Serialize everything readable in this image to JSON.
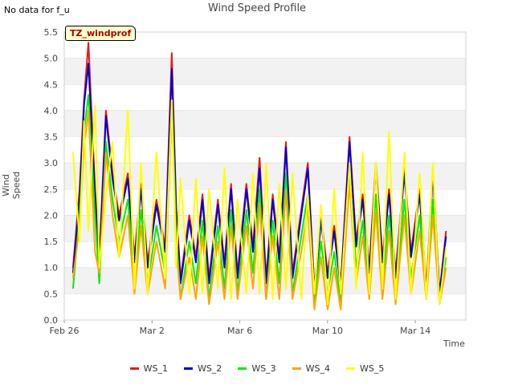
{
  "corner_note": "No data for f_u",
  "chart_data": {
    "type": "line",
    "title": "Wind Speed Profile",
    "site_label": "TZ_windprof",
    "xlabel": "Time",
    "ylabel": "Wind Speed",
    "x_ticks": [
      "Feb 26",
      "Mar 2",
      "Mar 6",
      "Mar 10",
      "Mar 14"
    ],
    "x_tick_days": [
      0,
      4,
      8,
      12,
      16
    ],
    "x_range_days": [
      0,
      18.3
    ],
    "y_ticks": [
      "0.0",
      "0.5",
      "1.0",
      "1.5",
      "2.0",
      "2.5",
      "3.0",
      "3.5",
      "4.0",
      "4.5",
      "5.0",
      "5.5"
    ],
    "ylim": [
      0,
      5.5
    ],
    "grid": "horizontal bands",
    "legend_position": "bottom",
    "series": [
      {
        "name": "WS_1",
        "color": "#e31a1c",
        "values": [
          [
            0.4,
            1.0
          ],
          [
            0.7,
            2.5
          ],
          [
            0.9,
            4.2
          ],
          [
            1.1,
            5.3
          ],
          [
            1.4,
            2.5
          ],
          [
            1.6,
            1.2
          ],
          [
            1.9,
            4.0
          ],
          [
            2.2,
            2.8
          ],
          [
            2.5,
            2.0
          ],
          [
            2.9,
            2.8
          ],
          [
            3.2,
            1.2
          ],
          [
            3.5,
            2.6
          ],
          [
            3.8,
            1.1
          ],
          [
            4.2,
            2.3
          ],
          [
            4.6,
            1.4
          ],
          [
            4.9,
            5.1
          ],
          [
            5.1,
            2.2
          ],
          [
            5.3,
            0.8
          ],
          [
            5.7,
            2.0
          ],
          [
            6.0,
            1.2
          ],
          [
            6.3,
            2.4
          ],
          [
            6.6,
            0.8
          ],
          [
            7.0,
            2.3
          ],
          [
            7.3,
            1.1
          ],
          [
            7.6,
            2.6
          ],
          [
            7.9,
            0.9
          ],
          [
            8.3,
            2.6
          ],
          [
            8.6,
            1.4
          ],
          [
            8.9,
            3.1
          ],
          [
            9.2,
            0.8
          ],
          [
            9.5,
            2.4
          ],
          [
            9.8,
            1.2
          ],
          [
            10.1,
            3.4
          ],
          [
            10.4,
            0.9
          ],
          [
            10.8,
            2.1
          ],
          [
            11.1,
            3.0
          ],
          [
            11.4,
            0.6
          ],
          [
            11.7,
            2.0
          ],
          [
            12.0,
            0.9
          ],
          [
            12.3,
            1.8
          ],
          [
            12.6,
            0.7
          ],
          [
            13.0,
            3.5
          ],
          [
            13.3,
            1.5
          ],
          [
            13.6,
            2.4
          ],
          [
            13.9,
            1.0
          ],
          [
            14.2,
            3.0
          ],
          [
            14.5,
            1.2
          ],
          [
            14.8,
            2.5
          ],
          [
            15.1,
            0.9
          ],
          [
            15.5,
            2.9
          ],
          [
            15.8,
            1.3
          ],
          [
            16.2,
            2.5
          ],
          [
            16.5,
            0.6
          ],
          [
            16.8,
            2.9
          ],
          [
            17.1,
            0.5
          ],
          [
            17.4,
            1.7
          ]
        ]
      },
      {
        "name": "WS_2",
        "color": "#0000cc",
        "values": [
          [
            0.4,
            0.9
          ],
          [
            0.7,
            2.3
          ],
          [
            0.9,
            4.1
          ],
          [
            1.1,
            4.9
          ],
          [
            1.4,
            2.4
          ],
          [
            1.6,
            1.1
          ],
          [
            1.9,
            3.9
          ],
          [
            2.2,
            2.7
          ],
          [
            2.5,
            1.9
          ],
          [
            2.9,
            2.7
          ],
          [
            3.2,
            1.1
          ],
          [
            3.5,
            2.5
          ],
          [
            3.8,
            1.0
          ],
          [
            4.2,
            2.2
          ],
          [
            4.6,
            1.3
          ],
          [
            4.9,
            4.8
          ],
          [
            5.1,
            2.1
          ],
          [
            5.3,
            0.7
          ],
          [
            5.7,
            1.9
          ],
          [
            6.0,
            1.1
          ],
          [
            6.3,
            2.3
          ],
          [
            6.6,
            0.7
          ],
          [
            7.0,
            2.2
          ],
          [
            7.3,
            1.0
          ],
          [
            7.6,
            2.5
          ],
          [
            7.9,
            0.8
          ],
          [
            8.3,
            2.5
          ],
          [
            8.6,
            1.3
          ],
          [
            8.9,
            2.9
          ],
          [
            9.2,
            0.7
          ],
          [
            9.5,
            2.3
          ],
          [
            9.8,
            1.1
          ],
          [
            10.1,
            3.3
          ],
          [
            10.4,
            0.8
          ],
          [
            10.8,
            2.0
          ],
          [
            11.1,
            2.9
          ],
          [
            11.4,
            0.5
          ],
          [
            11.7,
            1.9
          ],
          [
            12.0,
            0.8
          ],
          [
            12.3,
            1.7
          ],
          [
            12.6,
            0.6
          ],
          [
            13.0,
            3.4
          ],
          [
            13.3,
            1.4
          ],
          [
            13.6,
            2.3
          ],
          [
            13.9,
            0.9
          ],
          [
            14.2,
            2.9
          ],
          [
            14.5,
            1.1
          ],
          [
            14.8,
            2.4
          ],
          [
            15.1,
            0.8
          ],
          [
            15.5,
            2.8
          ],
          [
            15.8,
            1.2
          ],
          [
            16.2,
            2.4
          ],
          [
            16.5,
            0.5
          ],
          [
            16.8,
            2.8
          ],
          [
            17.1,
            0.5
          ],
          [
            17.4,
            1.6
          ]
        ]
      },
      {
        "name": "WS_3",
        "color": "#00ee00",
        "values": [
          [
            0.4,
            0.6
          ],
          [
            0.7,
            2.0
          ],
          [
            0.9,
            3.6
          ],
          [
            1.1,
            4.3
          ],
          [
            1.4,
            2.0
          ],
          [
            1.6,
            0.7
          ],
          [
            1.9,
            3.4
          ],
          [
            2.2,
            2.3
          ],
          [
            2.5,
            1.5
          ],
          [
            2.9,
            2.3
          ],
          [
            3.2,
            0.8
          ],
          [
            3.5,
            2.1
          ],
          [
            3.8,
            0.7
          ],
          [
            4.2,
            1.8
          ],
          [
            4.6,
            0.9
          ],
          [
            4.9,
            4.2
          ],
          [
            5.1,
            1.7
          ],
          [
            5.3,
            0.4
          ],
          [
            5.7,
            1.5
          ],
          [
            6.0,
            0.7
          ],
          [
            6.3,
            1.9
          ],
          [
            6.6,
            0.4
          ],
          [
            7.0,
            1.8
          ],
          [
            7.3,
            0.6
          ],
          [
            7.6,
            2.1
          ],
          [
            7.9,
            0.5
          ],
          [
            8.3,
            2.1
          ],
          [
            8.6,
            0.9
          ],
          [
            8.9,
            2.5
          ],
          [
            9.2,
            0.4
          ],
          [
            9.5,
            1.9
          ],
          [
            9.8,
            0.7
          ],
          [
            10.1,
            2.8
          ],
          [
            10.4,
            0.5
          ],
          [
            10.8,
            1.6
          ],
          [
            11.1,
            2.4
          ],
          [
            11.4,
            0.3
          ],
          [
            11.7,
            1.5
          ],
          [
            12.0,
            0.5
          ],
          [
            12.3,
            1.3
          ],
          [
            12.6,
            0.3
          ],
          [
            13.0,
            2.9
          ],
          [
            13.3,
            1.0
          ],
          [
            13.6,
            1.9
          ],
          [
            13.9,
            0.5
          ],
          [
            14.2,
            2.4
          ],
          [
            14.5,
            0.7
          ],
          [
            14.8,
            2.0
          ],
          [
            15.1,
            0.5
          ],
          [
            15.5,
            2.3
          ],
          [
            15.8,
            0.8
          ],
          [
            16.2,
            2.0
          ],
          [
            16.5,
            0.4
          ],
          [
            16.8,
            2.3
          ],
          [
            17.1,
            0.4
          ],
          [
            17.4,
            1.2
          ]
        ]
      },
      {
        "name": "WS_4",
        "color": "#ffa500",
        "values": [
          [
            0.4,
            0.8
          ],
          [
            0.7,
            1.8
          ],
          [
            0.9,
            3.3
          ],
          [
            1.1,
            4.0
          ],
          [
            1.4,
            1.3
          ],
          [
            1.6,
            0.9
          ],
          [
            1.9,
            3.2
          ],
          [
            2.2,
            2.0
          ],
          [
            2.5,
            1.2
          ],
          [
            2.9,
            2.0
          ],
          [
            3.2,
            0.5
          ],
          [
            3.5,
            1.8
          ],
          [
            3.8,
            0.5
          ],
          [
            4.2,
            1.5
          ],
          [
            4.6,
            0.6
          ],
          [
            4.9,
            4.0
          ],
          [
            5.1,
            1.4
          ],
          [
            5.3,
            0.4
          ],
          [
            5.7,
            1.2
          ],
          [
            6.0,
            0.4
          ],
          [
            6.3,
            1.6
          ],
          [
            6.6,
            0.3
          ],
          [
            7.0,
            1.5
          ],
          [
            7.3,
            0.4
          ],
          [
            7.6,
            1.8
          ],
          [
            7.9,
            0.4
          ],
          [
            8.3,
            1.8
          ],
          [
            8.6,
            0.6
          ],
          [
            8.9,
            2.2
          ],
          [
            9.2,
            0.4
          ],
          [
            9.5,
            1.6
          ],
          [
            9.8,
            0.4
          ],
          [
            10.1,
            2.5
          ],
          [
            10.4,
            0.4
          ],
          [
            10.8,
            1.3
          ],
          [
            11.1,
            2.1
          ],
          [
            11.4,
            0.2
          ],
          [
            11.7,
            1.2
          ],
          [
            12.0,
            0.2
          ],
          [
            12.3,
            1.0
          ],
          [
            12.6,
            0.2
          ],
          [
            13.0,
            2.6
          ],
          [
            13.3,
            0.7
          ],
          [
            13.6,
            1.6
          ],
          [
            13.9,
            0.4
          ],
          [
            14.2,
            2.1
          ],
          [
            14.5,
            0.4
          ],
          [
            14.8,
            1.7
          ],
          [
            15.1,
            0.3
          ],
          [
            15.5,
            2.0
          ],
          [
            15.8,
            0.5
          ],
          [
            16.2,
            1.7
          ],
          [
            16.5,
            0.4
          ],
          [
            16.8,
            2.0
          ],
          [
            17.1,
            0.3
          ],
          [
            17.4,
            1.0
          ]
        ]
      },
      {
        "name": "WS_5",
        "color": "#ffff00",
        "values": [
          [
            0.4,
            3.2
          ],
          [
            0.7,
            1.5
          ],
          [
            0.9,
            3.8
          ],
          [
            1.1,
            1.7
          ],
          [
            1.4,
            4.1
          ],
          [
            1.6,
            1.0
          ],
          [
            1.9,
            2.4
          ],
          [
            2.2,
            3.4
          ],
          [
            2.5,
            1.2
          ],
          [
            2.9,
            4.0
          ],
          [
            3.2,
            0.6
          ],
          [
            3.5,
            3.0
          ],
          [
            3.8,
            0.5
          ],
          [
            4.2,
            3.2
          ],
          [
            4.6,
            0.8
          ],
          [
            4.9,
            4.2
          ],
          [
            5.1,
            1.0
          ],
          [
            5.3,
            2.7
          ],
          [
            5.7,
            0.5
          ],
          [
            6.0,
            2.7
          ],
          [
            6.3,
            0.5
          ],
          [
            6.6,
            2.5
          ],
          [
            7.0,
            0.6
          ],
          [
            7.3,
            2.9
          ],
          [
            7.6,
            0.4
          ],
          [
            7.9,
            2.3
          ],
          [
            8.3,
            0.5
          ],
          [
            8.6,
            2.8
          ],
          [
            8.9,
            0.5
          ],
          [
            9.2,
            3.0
          ],
          [
            9.5,
            0.4
          ],
          [
            9.8,
            2.6
          ],
          [
            10.1,
            0.6
          ],
          [
            10.4,
            2.8
          ],
          [
            10.8,
            0.4
          ],
          [
            11.1,
            2.4
          ],
          [
            11.4,
            0.5
          ],
          [
            11.7,
            2.2
          ],
          [
            12.0,
            0.3
          ],
          [
            12.3,
            2.5
          ],
          [
            12.6,
            0.5
          ],
          [
            13.0,
            3.0
          ],
          [
            13.3,
            0.6
          ],
          [
            13.6,
            3.2
          ],
          [
            13.9,
            0.5
          ],
          [
            14.2,
            3.0
          ],
          [
            14.5,
            0.6
          ],
          [
            14.8,
            3.6
          ],
          [
            15.1,
            0.4
          ],
          [
            15.5,
            3.2
          ],
          [
            15.8,
            0.5
          ],
          [
            16.2,
            2.8
          ],
          [
            16.5,
            0.4
          ],
          [
            16.8,
            3.0
          ],
          [
            17.1,
            0.3
          ],
          [
            17.4,
            1.4
          ]
        ]
      }
    ]
  }
}
